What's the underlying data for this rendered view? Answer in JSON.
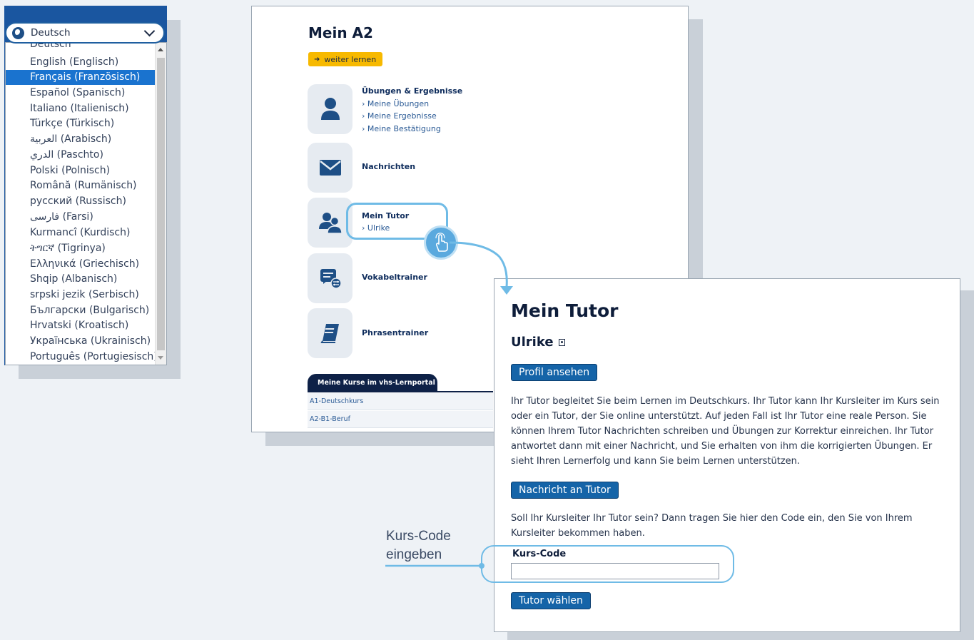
{
  "language_selector": {
    "selected": "Deutsch",
    "icon": "globe-icon",
    "options": [
      "Deutsch",
      "English (Englisch)",
      "Français (Französisch)",
      "Español (Spanisch)",
      "Italiano (Italienisch)",
      "Türkçe (Türkisch)",
      "العربية (Arabisch)",
      "الدري (Paschto)",
      "Polski (Polnisch)",
      "Română (Rumänisch)",
      "русский (Russisch)",
      "فارسی (Farsi)",
      "Kurmancî (Kurdisch)",
      "ትግርኛ (Tigrinya)",
      "Ελληνικά (Griechisch)",
      "Shqip (Albanisch)",
      "srpski jezik (Serbisch)",
      "Български (Bulgarisch)",
      "Hrvatski (Kroatisch)",
      "Українська (Ukrainisch)",
      "Português (Portugiesisch)"
    ],
    "highlighted_option": "Français (Französisch)"
  },
  "dashboard": {
    "title": "Mein A2",
    "continue_button": "weiter lernen",
    "menu": {
      "uebungen": {
        "title": "Übungen & Ergebnisse",
        "links": [
          "› Meine Übungen",
          "› Meine Ergebnisse",
          "› Meine Bestätigung"
        ]
      },
      "nachrichten": {
        "title": "Nachrichten"
      },
      "tutor": {
        "title": "Mein Tutor",
        "link": "› Ulrike"
      },
      "vokabel": {
        "title": "Vokabeltrainer"
      },
      "phrasen": {
        "title": "Phrasentrainer"
      }
    },
    "courses": {
      "tab_label": "Meine Kurse im vhs-Lernportal",
      "items": [
        "A1-Deutschkurs",
        "A2-B1-Beruf"
      ]
    }
  },
  "tutor_page": {
    "title": "Mein Tutor",
    "tutor_name": "Ulrike",
    "profile_button": "Profil ansehen",
    "description": "Ihr Tutor begleitet Sie beim Lernen im Deutschkurs. Ihr Tutor kann Ihr Kursleiter im Kurs sein oder ein Tutor, der Sie online unterstützt. Auf jeden Fall ist Ihr Tutor eine reale Person. Sie können Ihrem Tutor Nachrichten schreiben und Übungen zur Korrektur einreichen. Ihr Tutor antwortet dann mit einer Nachricht, und Sie erhalten von ihm die korrigierten Übungen. Er sieht Ihren Lernerfolg und kann Sie beim Lernen unterstützen.",
    "message_button": "Nachricht an Tutor",
    "code_prompt": "Soll Ihr Kursleiter Ihr Tutor sein? Dann tragen Sie hier den Code ein, den Sie von Ihrem Kursleiter bekommen haben.",
    "code_label": "Kurs-Code",
    "code_value": "",
    "choose_button": "Tutor wählen"
  },
  "annotation": {
    "line1": "Kurs-Code",
    "line2": "eingeben"
  },
  "colors": {
    "accent_blue": "#1564a8",
    "highlight": "#6fbbe6",
    "continue_yellow": "#f7b900",
    "navy": "#0e2147"
  }
}
